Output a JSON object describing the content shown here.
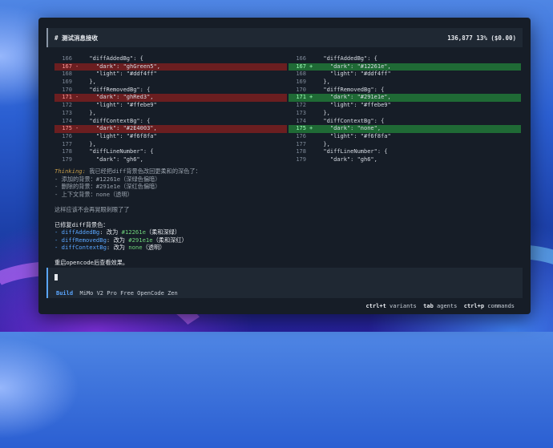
{
  "header": {
    "title": "# 测试消息接收",
    "stats": "136,877  13% ($0.00)"
  },
  "diff": {
    "left": [
      {
        "num": "166",
        "mark": "",
        "code": "  \"diffAddedBg\": {",
        "type": "context"
      },
      {
        "num": "167",
        "mark": "-",
        "code": "    \"dark\": \"ghGreen5\",",
        "type": "removed"
      },
      {
        "num": "168",
        "mark": "",
        "code": "    \"light\": \"#ddf4ff\"",
        "type": "context"
      },
      {
        "num": "169",
        "mark": "",
        "code": "  },",
        "type": "context"
      },
      {
        "num": "170",
        "mark": "",
        "code": "  \"diffRemovedBg\": {",
        "type": "context"
      },
      {
        "num": "171",
        "mark": "-",
        "code": "    \"dark\": \"ghRed3\",",
        "type": "removed"
      },
      {
        "num": "172",
        "mark": "",
        "code": "    \"light\": \"#ffebe9\"",
        "type": "context"
      },
      {
        "num": "173",
        "mark": "",
        "code": "  },",
        "type": "context"
      },
      {
        "num": "174",
        "mark": "",
        "code": "  \"diffContextBg\": {",
        "type": "context"
      },
      {
        "num": "175",
        "mark": "-",
        "code": "    \"dark\": \"#2E4003\",",
        "type": "removed"
      },
      {
        "num": "176",
        "mark": "",
        "code": "    \"light\": \"#f6f8fa\"",
        "type": "context"
      },
      {
        "num": "177",
        "mark": "",
        "code": "  },",
        "type": "context"
      },
      {
        "num": "178",
        "mark": "",
        "code": "  \"diffLineNumber\": {",
        "type": "context"
      },
      {
        "num": "179",
        "mark": "",
        "code": "    \"dark\": \"gh6\",",
        "type": "context"
      }
    ],
    "right": [
      {
        "num": "166",
        "mark": "",
        "code": "  \"diffAddedBg\": {",
        "type": "context"
      },
      {
        "num": "167",
        "mark": "+",
        "code": "    \"dark\": \"#12261e\",",
        "type": "added"
      },
      {
        "num": "168",
        "mark": "",
        "code": "    \"light\": \"#ddf4ff\"",
        "type": "context"
      },
      {
        "num": "169",
        "mark": "",
        "code": "  },",
        "type": "context"
      },
      {
        "num": "170",
        "mark": "",
        "code": "  \"diffRemovedBg\": {",
        "type": "context"
      },
      {
        "num": "171",
        "mark": "+",
        "code": "    \"dark\": \"#291e1e\",",
        "type": "added"
      },
      {
        "num": "172",
        "mark": "",
        "code": "    \"light\": \"#ffebe9\"",
        "type": "context"
      },
      {
        "num": "173",
        "mark": "",
        "code": "  },",
        "type": "context"
      },
      {
        "num": "174",
        "mark": "",
        "code": "  \"diffContextBg\": {",
        "type": "context"
      },
      {
        "num": "175",
        "mark": "+",
        "code": "    \"dark\": \"none\",",
        "type": "added"
      },
      {
        "num": "176",
        "mark": "",
        "code": "    \"light\": \"#f6f8fa\"",
        "type": "context"
      },
      {
        "num": "177",
        "mark": "",
        "code": "  },",
        "type": "context"
      },
      {
        "num": "178",
        "mark": "",
        "code": "  \"diffLineNumber\": {",
        "type": "context"
      },
      {
        "num": "179",
        "mark": "",
        "code": "    \"dark\": \"gh6\",",
        "type": "context"
      }
    ]
  },
  "message": {
    "thinking_label": "Thinking:",
    "thinking_text": " 我已经把diff背景色改回更柔和的深色了：",
    "thinking_items": [
      "- 添加的背景：#12261e（深绿色偏暗）",
      "- 删除的背景：#291e1e（深红色偏暗）",
      "- 上下文背景：none（透明）"
    ],
    "note": "这样应该不会再晃眼刺眼了了",
    "fixed_intro": "已修复diff背景色：",
    "fixed_items": [
      {
        "key": "- diffAddedBg",
        "sep": ": 改为 ",
        "value": "#12261e",
        "desc": "（柔和深绿）"
      },
      {
        "key": "- diffRemovedBg",
        "sep": ": 改为 ",
        "value": "#291e1e",
        "desc": "（柔和深红）"
      },
      {
        "key": "- diffContextBg",
        "sep": ": 改为 ",
        "value": "none",
        "desc": "（透明）"
      }
    ],
    "restart": "重启opencode后查看效果。"
  },
  "statusline": {
    "mode": "Build",
    "model": "  MiMo V2 Pro Free OpenCode Zen"
  },
  "footer": {
    "k1": "ctrl+t",
    "l1": " variants  ",
    "k2": "tab",
    "l2": " agents  ",
    "k3": "ctrl+p",
    "l3": " commands"
  },
  "colors": {
    "accent": "#5aa6ff",
    "removed_bg": "#6b1e20",
    "added_bg": "#1f6a35",
    "thinking": "#c39a48"
  }
}
